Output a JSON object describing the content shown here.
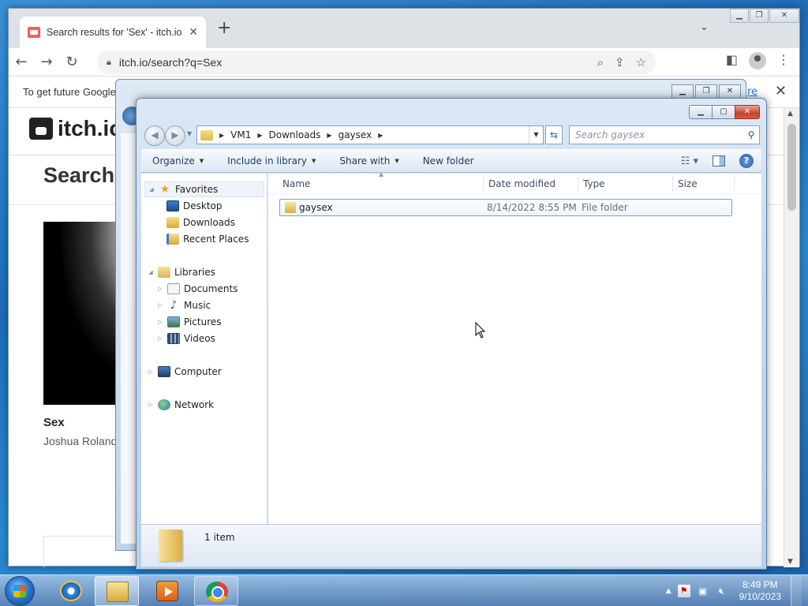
{
  "browser": {
    "tab_title": "Search results for 'Sex' - itch.io",
    "url": "itch.io/search?q=Sex",
    "infobar_text": "To get future Google",
    "infobar_link": "re",
    "logo_text": "itch.io",
    "search_heading": "Search r",
    "result": {
      "title": "Sex",
      "author": "Joshua Roland"
    }
  },
  "explorer": {
    "breadcrumbs": [
      "VM1",
      "Downloads",
      "gaysex"
    ],
    "search_placeholder": "Search gaysex",
    "commands": {
      "organize": "Organize",
      "include_in_library": "Include in library",
      "share_with": "Share with",
      "new_folder": "New folder"
    },
    "nav": {
      "favorites": "Favorites",
      "desktop": "Desktop",
      "downloads": "Downloads",
      "recent_places": "Recent Places",
      "libraries": "Libraries",
      "documents": "Documents",
      "music": "Music",
      "pictures": "Pictures",
      "videos": "Videos",
      "computer": "Computer",
      "network": "Network"
    },
    "columns": {
      "name": "Name",
      "date_modified": "Date modified",
      "type": "Type",
      "size": "Size"
    },
    "files": [
      {
        "name": "gaysex",
        "date_modified": "8/14/2022 8:55 PM",
        "type": "File folder",
        "size": ""
      }
    ],
    "status": "1 item"
  },
  "taskbar": {
    "time": "8:49 PM",
    "date": "9/10/2023"
  }
}
